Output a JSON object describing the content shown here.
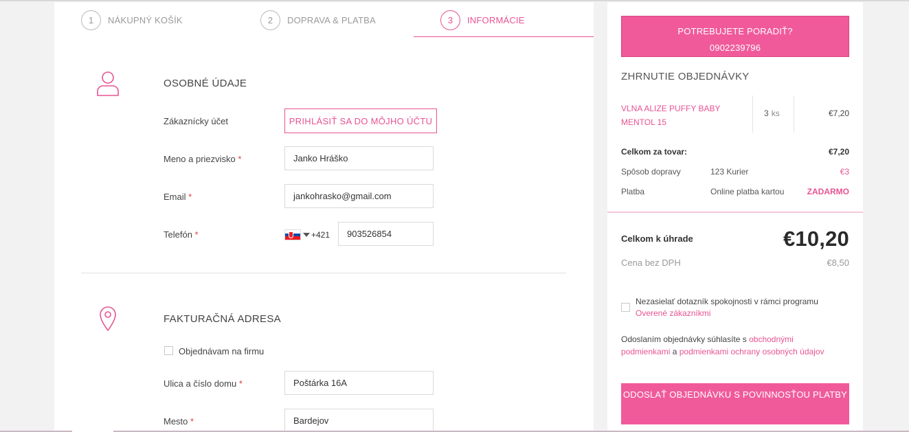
{
  "steps": [
    {
      "num": "1",
      "label": "NÁKUPNÝ KOŠÍK"
    },
    {
      "num": "2",
      "label": "DOPRAVA & PLATBA"
    },
    {
      "num": "3",
      "label": "INFORMÁCIE"
    }
  ],
  "personal": {
    "title": "OSOBNÉ ÚDAJE",
    "account_label": "Zákaznícky účet",
    "login_button": "PRIHLÁSIŤ SA DO MÔJHO ÚČTU",
    "name_label": "Meno a priezvisko",
    "name_value": "Janko Hráško",
    "email_label": "Email",
    "email_value": "jankohrasko@gmail.com",
    "phone_label": "Telefón",
    "phone_prefix": "+421",
    "phone_value": "903526854",
    "required_mark": "*"
  },
  "billing": {
    "title": "FAKTURAČNÁ ADRESA",
    "company_checkbox_label": "Objednávam na firmu",
    "street_label": "Ulica a číslo domu",
    "street_value": "Poštárka 16A",
    "city_label": "Mesto",
    "city_value": "Bardejov"
  },
  "help": {
    "label": "POTREBUJETE PORADIŤ?",
    "phone": "0902239796"
  },
  "summary": {
    "title": "ZHRNUTIE OBJEDNÁVKY",
    "item": {
      "name": "VLNA ALIZE PUFFY BABY MENTOL 15",
      "qty": "3",
      "unit": "ks",
      "price": "€7,20"
    },
    "goods_total_label": "Celkom za tovar:",
    "goods_total_value": "€7,20",
    "shipping_label": "Spôsob dopravy",
    "shipping_method": "123 Kurier",
    "shipping_price": "€3",
    "payment_label": "Platba",
    "payment_method": "Online platba kartou",
    "payment_price": "ZADARMO",
    "total_label": "Celkom k úhrade",
    "total_value": "€10,20",
    "no_vat_label": "Cena bez DPH",
    "no_vat_value": "€8,50"
  },
  "survey": {
    "text": "Nezasielať dotazník spokojnosti v rámci programu",
    "link": "Overené zákazníkmi"
  },
  "terms": {
    "prefix": "Odoslaním objednávky súhlasíte s",
    "link1": "obchodnými podmienkami",
    "middle": "a",
    "link2": "podmienkami ochrany osobných údajov"
  },
  "submit_button": "ODOSLAŤ OBJEDNÁVKU S POVINNOSŤOU PLATBY",
  "colors": {
    "accent": "#e85392",
    "button_bg": "#f05a9b",
    "background": "#f2f2f2"
  },
  "icons": [
    "user-icon",
    "location-pin-icon",
    "dropdown-caret-icon",
    "slovakia-flag-icon"
  ]
}
